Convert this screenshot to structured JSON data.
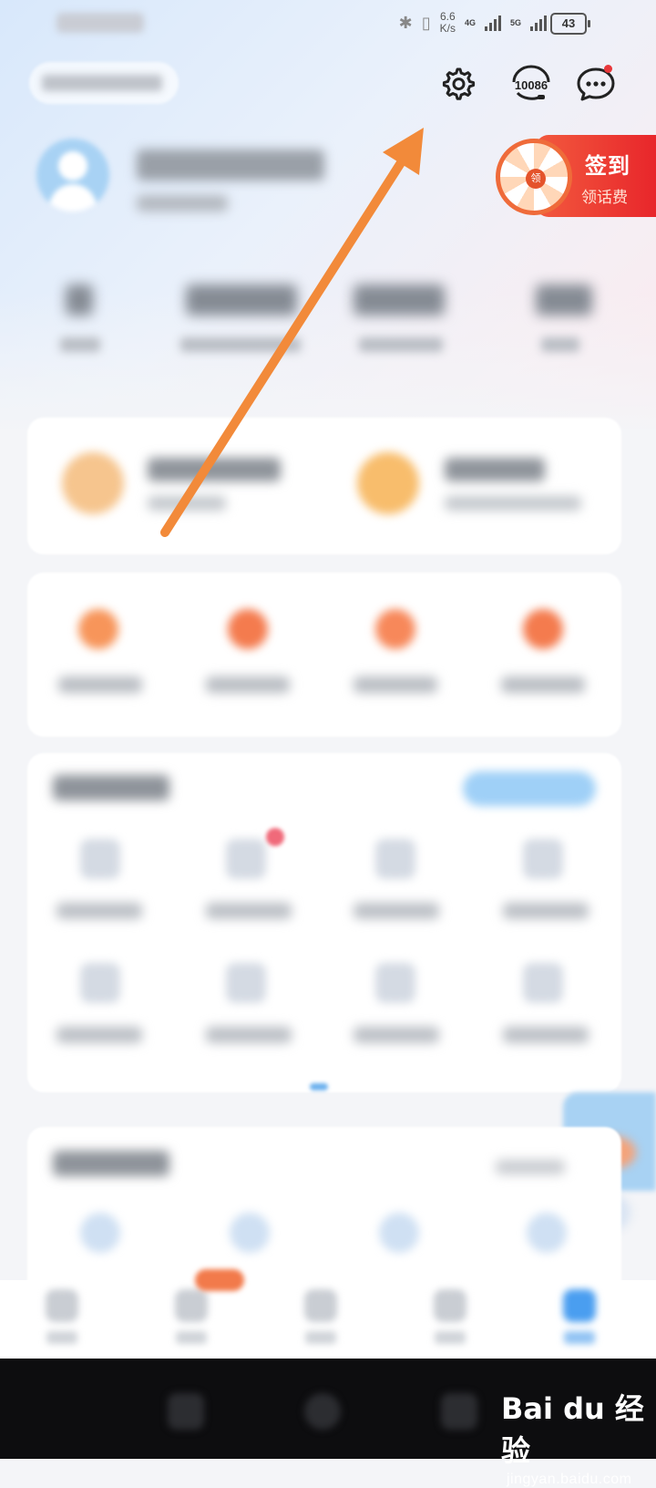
{
  "status_bar": {
    "speed_value": "6.6",
    "speed_unit": "K/s",
    "network1": "4G",
    "network2": "5G",
    "battery": "43"
  },
  "header": {
    "service_number": "10086",
    "settings_icon": "gear-icon",
    "service_icon": "headset-icon",
    "message_icon": "chat-bubble-icon"
  },
  "signin_banner": {
    "title": "签到",
    "subtitle": "领话费",
    "wheel_label": "领"
  },
  "colors": {
    "accent_orange": "#f08a3c",
    "banner_red": "#e8262b",
    "arrow": "#f28a3a"
  },
  "watermark": {
    "brand": "Bai du 经验",
    "url": "jingyan.baidu.com"
  }
}
